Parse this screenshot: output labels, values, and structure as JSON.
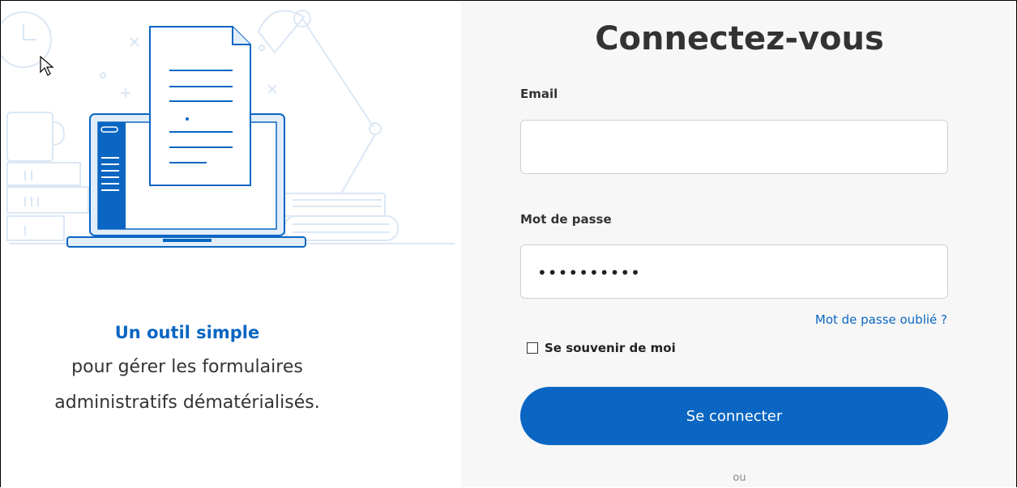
{
  "hero": {
    "title": "Un outil simple",
    "line1": "pour gérer les formulaires",
    "line2": "administratifs dématérialisés."
  },
  "login": {
    "title": "Connectez-vous",
    "email_label": "Email",
    "email_value": "",
    "password_label": "Mot de passe",
    "password_value": "••••••••••",
    "forgot_link": "Mot de passe oublié ?",
    "remember_label": "Se souvenir de moi",
    "remember_checked": false,
    "submit_label": "Se connecter",
    "or_text": "ou"
  },
  "colors": {
    "accent": "#0a66c2",
    "panel_bg": "#f7f7f7",
    "illustration_line": "#d9e6f5"
  }
}
